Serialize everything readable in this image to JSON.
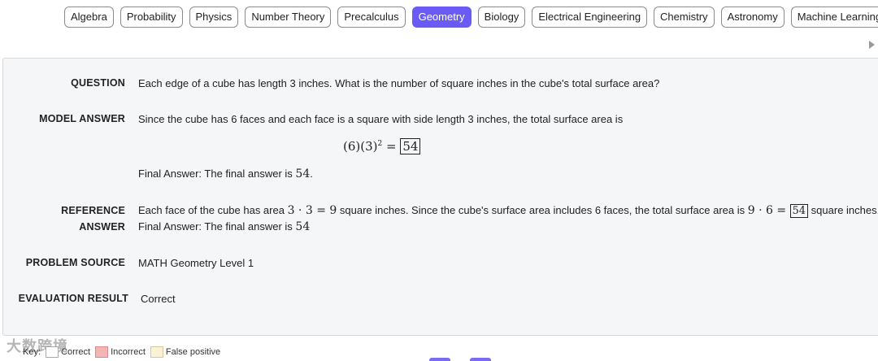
{
  "tabs": [
    {
      "label": "Algebra",
      "active": false
    },
    {
      "label": "Probability",
      "active": false
    },
    {
      "label": "Physics",
      "active": false
    },
    {
      "label": "Number Theory",
      "active": false
    },
    {
      "label": "Precalculus",
      "active": false
    },
    {
      "label": "Geometry",
      "active": true
    },
    {
      "label": "Biology",
      "active": false
    },
    {
      "label": "Electrical Engineering",
      "active": false
    },
    {
      "label": "Chemistry",
      "active": false
    },
    {
      "label": "Astronomy",
      "active": false
    },
    {
      "label": "Machine Learning",
      "active": false
    }
  ],
  "accent_color": "#6b5bf5",
  "question": {
    "label": "QUESTION",
    "text": "Each edge of a cube has length 3 inches. What is the number of square inches in the cube's total surface area?"
  },
  "model_answer": {
    "label": "MODEL ANSWER",
    "text": "Since the cube has 6 faces and each face is a square with side length 3 inches, the total surface area is",
    "equation_left": "(6)(3)",
    "equation_exp": "2",
    "equation_eq": " = ",
    "equation_result": "54",
    "final": "Final Answer: The final answer is ",
    "final_value": "54",
    "final_end": "."
  },
  "reference_answer": {
    "label_line1": "REFERENCE",
    "label_line2": "ANSWER",
    "text_a": "Each face of the cube has area ",
    "math_a": "3 · 3 = 9",
    "text_b": " square inches. Since the cube's surface area includes 6 faces, the total surface area is ",
    "math_b": "9 · 6 = ",
    "boxed": "54",
    "text_c": " square inches.",
    "final": "Final Answer: The final answer is ",
    "final_value": "54"
  },
  "problem_source": {
    "label": "PROBLEM SOURCE",
    "value": "MATH Geometry Level 1"
  },
  "evaluation": {
    "label": "EVALUATION RESULT",
    "value": "Correct"
  },
  "key": {
    "title": "Key:",
    "correct": "Correct",
    "incorrect": "Incorrect",
    "false_positive": "False positive"
  },
  "watermark": "大数跨境"
}
